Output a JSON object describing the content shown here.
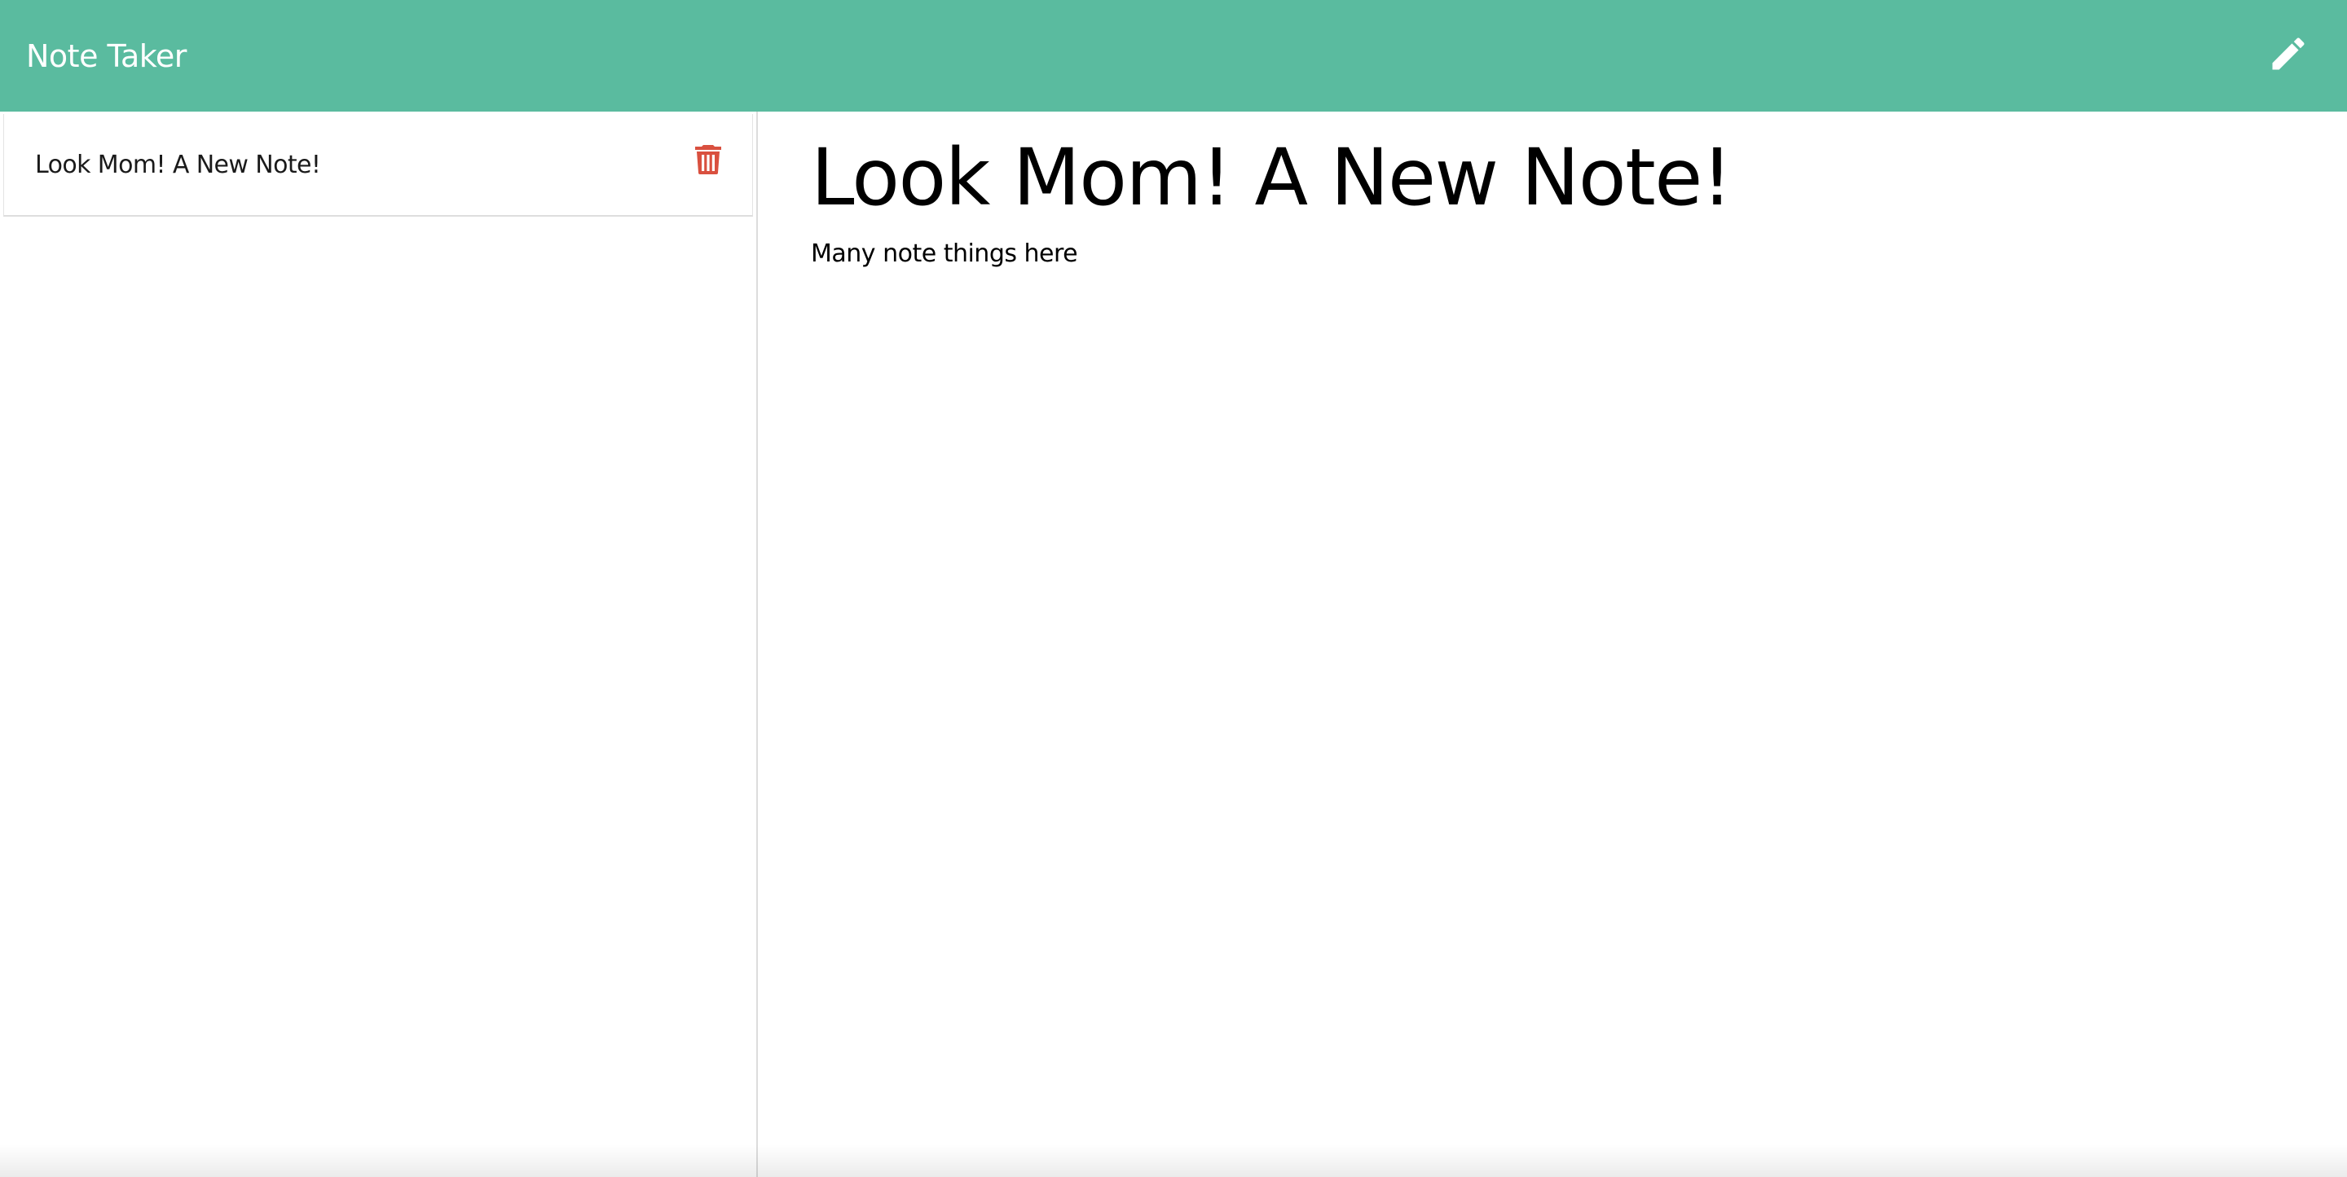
{
  "navbar": {
    "brand": "Note Taker",
    "bg_color": "#5abb9f",
    "new_note_icon": "pencil-icon"
  },
  "sidebar": {
    "notes": [
      {
        "title": "Look Mom! A New Note!",
        "delete_icon": "trash-icon",
        "delete_color": "#d9503f"
      }
    ]
  },
  "main": {
    "note_title": "Look Mom! A New Note!",
    "note_text": "Many note things here"
  }
}
